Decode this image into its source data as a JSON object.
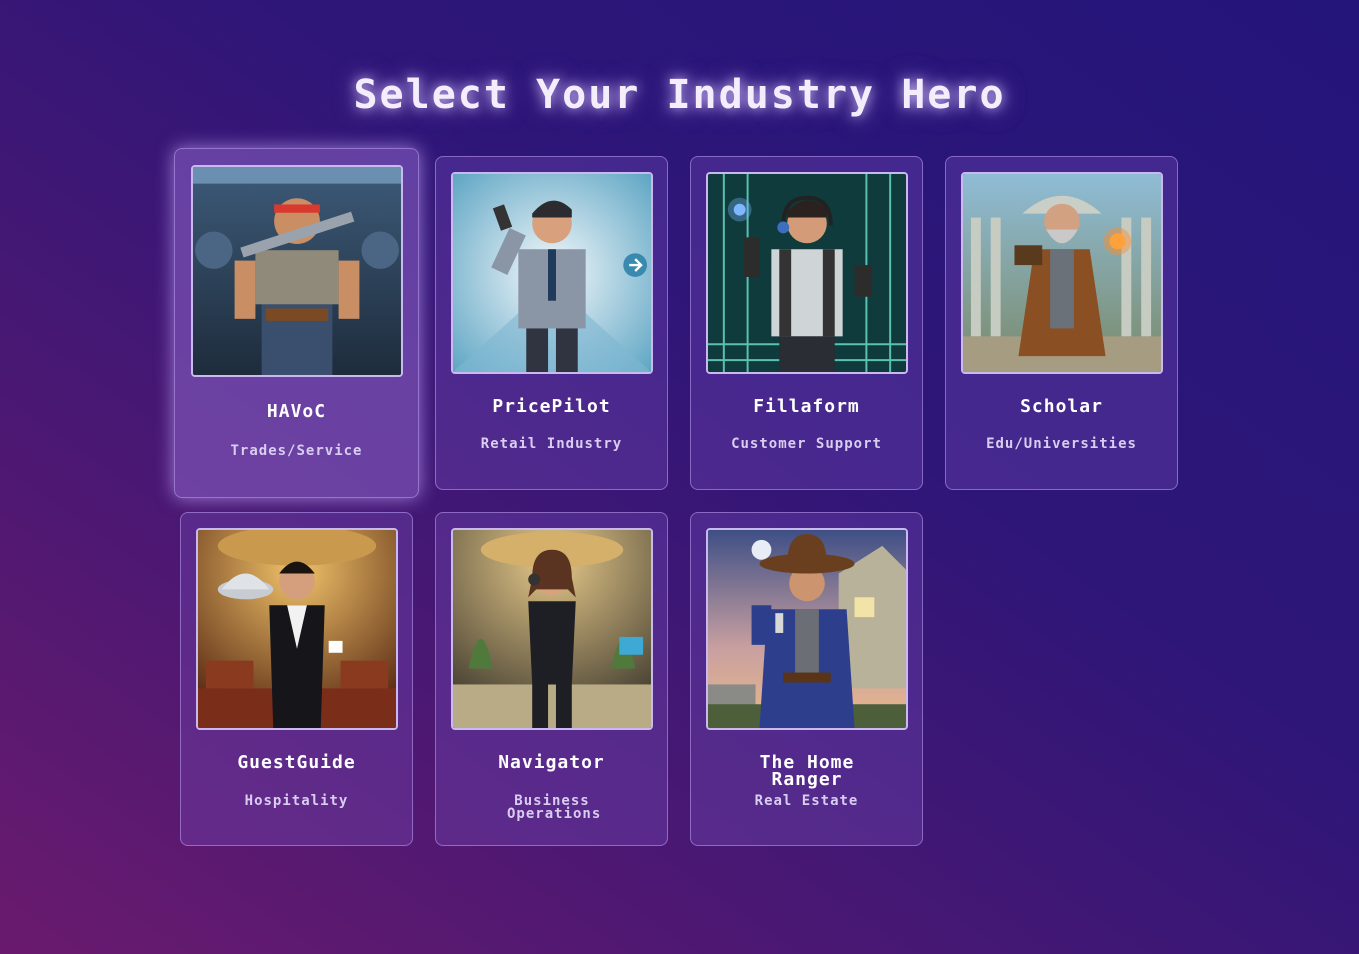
{
  "page": {
    "title": "Select Your Industry Hero"
  },
  "heroes": [
    {
      "name": "HAVoC",
      "role": "Trades/Service",
      "selected": true,
      "portrait_icon": "plumber-hero-icon"
    },
    {
      "name": "PricePilot",
      "role": "Retail Industry",
      "selected": false,
      "portrait_icon": "retail-hero-icon"
    },
    {
      "name": "Fillaform",
      "role": "Customer Support",
      "selected": false,
      "portrait_icon": "support-hero-icon"
    },
    {
      "name": "Scholar",
      "role": "Edu/Universities",
      "selected": false,
      "portrait_icon": "scholar-hero-icon"
    },
    {
      "name": "GuestGuide",
      "role": "Hospitality",
      "selected": false,
      "portrait_icon": "butler-hero-icon"
    },
    {
      "name": "Navigator",
      "role": "Business Operations",
      "selected": false,
      "portrait_icon": "business-hero-icon"
    },
    {
      "name": "The Home Ranger",
      "role": "Real Estate",
      "selected": false,
      "portrait_icon": "cowboy-hero-icon"
    }
  ],
  "colors": {
    "background_start": "#6a1a6e",
    "background_end": "#24157a",
    "card_border": "#c9b9ee",
    "role_text": "#d9cdf2"
  }
}
